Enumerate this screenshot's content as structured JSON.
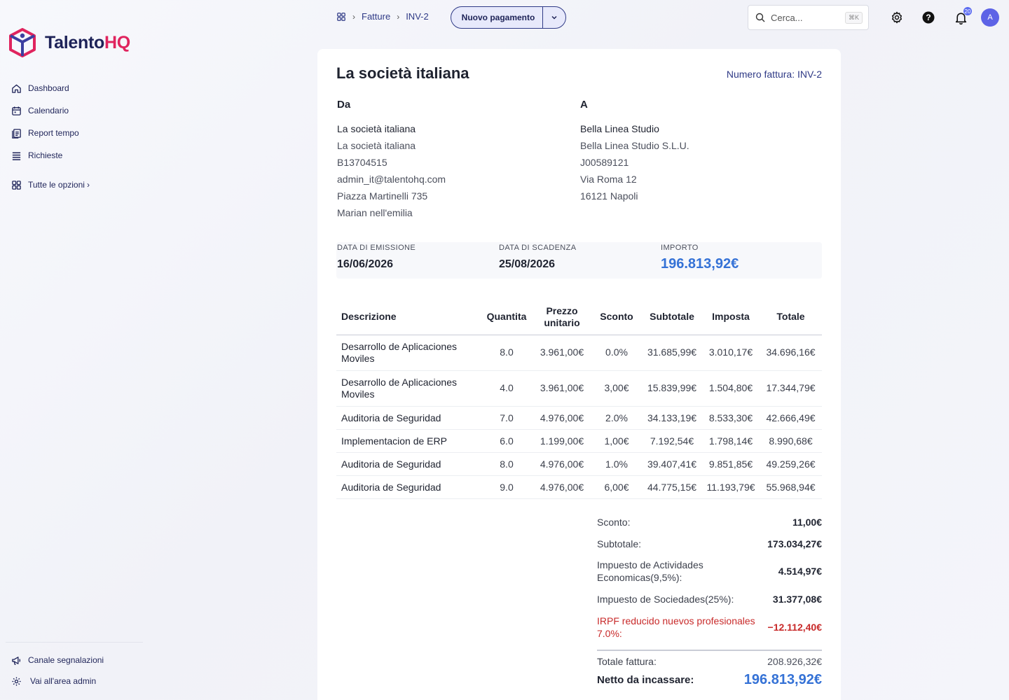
{
  "app": {
    "logo_main": "Talento",
    "logo_accent": "HQ"
  },
  "sidebar": {
    "items": [
      {
        "label": "Dashboard",
        "icon": "home-icon"
      },
      {
        "label": "Calendario",
        "icon": "calendar-icon"
      },
      {
        "label": "Report tempo",
        "icon": "report-icon"
      },
      {
        "label": "Richieste",
        "icon": "list-icon"
      }
    ],
    "all_options": "Tutte le opzioni",
    "bottom": [
      {
        "label": "Canale segnalazioni",
        "icon": "megaphone-icon"
      },
      {
        "label": "Vai all'area admin",
        "icon": "gear-icon"
      }
    ]
  },
  "topbar": {
    "breadcrumb": [
      "Fatture",
      "INV-2"
    ],
    "primary_action": "Nuovo pagamento",
    "search_placeholder": "Cerca...",
    "search_shortcut": "⌘K",
    "notifications_count": "20",
    "avatar_initial": "A"
  },
  "invoice": {
    "title": "La società italiana",
    "number": "Numero fattura: INV-2",
    "from": {
      "heading": "Da",
      "name": "La società italiana",
      "lines": [
        "La società italiana",
        "B13704515",
        "admin_it@talentohq.com",
        "Piazza Martinelli 735",
        "Marian nell'emilia"
      ]
    },
    "to": {
      "heading": "A",
      "name": "Bella Linea Studio",
      "lines": [
        "Bella Linea Studio S.L.U.",
        "J00589121",
        "Via Roma 12",
        "16121 Napoli"
      ]
    },
    "summary": {
      "issue_label": "DATA DI EMISSIONE",
      "issue_value": "16/06/2026",
      "due_label": "DATA DI SCADENZA",
      "due_value": "25/08/2026",
      "amount_label": "IMPORTO",
      "amount_value": "196.813,92€"
    },
    "table": {
      "headers": [
        "Descrizione",
        "Quantita",
        "Prezzo unitario",
        "Sconto",
        "Subtotale",
        "Imposta",
        "Totale"
      ],
      "rows": [
        [
          "Desarrollo de Aplicaciones Moviles",
          "8.0",
          "3.961,00€",
          "0.0%",
          "31.685,99€",
          "3.010,17€",
          "34.696,16€"
        ],
        [
          "Desarrollo de Aplicaciones Moviles",
          "4.0",
          "3.961,00€",
          "3,00€",
          "15.839,99€",
          "1.504,80€",
          "17.344,79€"
        ],
        [
          "Auditoria de Seguridad",
          "7.0",
          "4.976,00€",
          "2.0%",
          "34.133,19€",
          "8.533,30€",
          "42.666,49€"
        ],
        [
          "Implementacion de ERP",
          "6.0",
          "1.199,00€",
          "1,00€",
          "7.192,54€",
          "1.798,14€",
          "8.990,68€"
        ],
        [
          "Auditoria de Seguridad",
          "8.0",
          "4.976,00€",
          "1.0%",
          "39.407,41€",
          "9.851,85€",
          "49.259,26€"
        ],
        [
          "Auditoria de Seguridad",
          "9.0",
          "4.976,00€",
          "6,00€",
          "44.775,15€",
          "11.193,79€",
          "55.968,94€"
        ]
      ]
    },
    "totals": {
      "discount_label": "Sconto:",
      "discount_value": "11,00€",
      "subtotal_label": "Subtotale:",
      "subtotal_value": "173.034,27€",
      "tax1_label": "Impuesto de Actividades Economicas(9,5%):",
      "tax1_value": "4.514,97€",
      "tax2_label": "Impuesto de Sociedades(25%):",
      "tax2_value": "31.377,08€",
      "irpf_label": "IRPF reducido nuevos profesionales 7.0%:",
      "irpf_value": "−12.112,40€",
      "total_label": "Totale fattura:",
      "total_value": "208.926,32€",
      "net_label": "Netto da incassare:",
      "net_value": "196.813,92€"
    }
  },
  "colors": {
    "brand": "#1e2358",
    "accent": "#e0245e",
    "link": "#2f3a86",
    "amount": "#3572d6",
    "negative": "#c82a2a"
  }
}
